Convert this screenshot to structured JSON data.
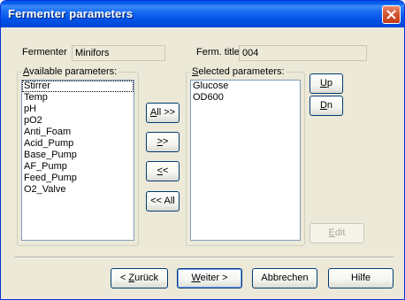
{
  "window": {
    "title": "Fermenter parameters"
  },
  "fermenter": {
    "label": "Fermenter",
    "value": "Minifors"
  },
  "ferm_title": {
    "label": "Ferm. title:",
    "value": "004"
  },
  "available": {
    "label_accel": "A",
    "label_rest": "vailable parameters:",
    "items": [
      "Stirrer",
      "Temp",
      "pH",
      "pO2",
      "Anti_Foam",
      "Acid_Pump",
      "Base_Pump",
      "AF_Pump",
      "Feed_Pump",
      "O2_Valve"
    ]
  },
  "selected": {
    "label_accel": "S",
    "label_rest": "elected parameters:",
    "items": [
      "Glucose",
      "OD600"
    ]
  },
  "transfer_buttons": {
    "all_right_accel": "A",
    "all_right_rest": "ll >>",
    "right_accel": ">",
    "right_rest": ">",
    "left_accel": "<",
    "left_rest": "<",
    "all_left": "<< All"
  },
  "order_buttons": {
    "up_accel": "U",
    "up_rest": "p",
    "down_accel": "D",
    "down_rest": "n"
  },
  "edit_button": {
    "accel": "E",
    "rest": "dit"
  },
  "footer": {
    "back_prefix": "< ",
    "back_accel": "Z",
    "back_rest": "urück",
    "next_accel": "W",
    "next_rest": "eiter >",
    "cancel": "Abbrechen",
    "help": "Hilfe"
  },
  "colors": {
    "titlebar": "#0054e3",
    "close_button": "#d2532e",
    "dialog_face": "#ece9d8"
  }
}
